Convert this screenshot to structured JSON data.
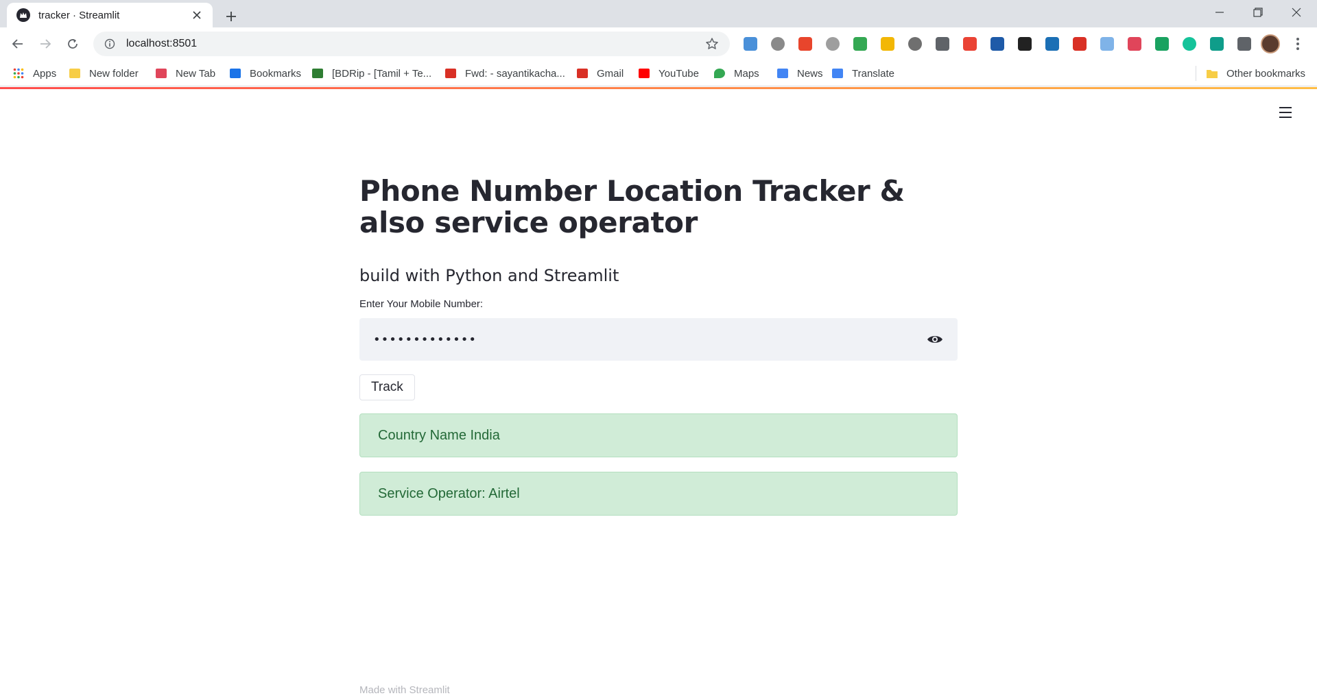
{
  "browser": {
    "tab_title": "tracker · Streamlit",
    "url": "localhost:8501",
    "extensions": [
      {
        "name": "google-translate-icon",
        "color": "#4a90d9"
      },
      {
        "name": "search-ext-icon",
        "color": "#8a8a8a"
      },
      {
        "name": "bracket-ext-icon",
        "color": "#e8452c"
      },
      {
        "name": "magnifier-ext-icon",
        "color": "#9e9e9e"
      },
      {
        "name": "chrome-ext-icon",
        "color": "#34a853"
      },
      {
        "name": "paytm-ext-icon",
        "color": "#f2b705"
      },
      {
        "name": "globe-ext-icon",
        "color": "#6f6f6f"
      },
      {
        "name": "gamepad-ext-icon",
        "color": "#5f6368"
      },
      {
        "name": "chrome2-ext-icon",
        "color": "#ea4335"
      },
      {
        "name": "clapper-ext-icon",
        "color": "#1e5aa8"
      },
      {
        "name": "card-ext-icon",
        "color": "#222222"
      },
      {
        "name": "clapper2-ext-icon",
        "color": "#1b6fb5"
      },
      {
        "name": "forward-ext-icon",
        "color": "#d93025"
      },
      {
        "name": "doc-ext-icon",
        "color": "#7fb3e8"
      },
      {
        "name": "tv-ext-icon",
        "color": "#e0455a"
      },
      {
        "name": "shield-ext-icon",
        "color": "#1aa260"
      },
      {
        "name": "grammarly-icon",
        "color": "#15c39a"
      },
      {
        "name": "pen-ext-icon",
        "color": "#0f9d8a"
      },
      {
        "name": "puzzle-icon",
        "color": "#5f6368"
      }
    ]
  },
  "bookmarks": {
    "apps": "Apps",
    "items": [
      {
        "label": "New folder",
        "color": "#f7cd46"
      },
      {
        "label": "New Tab",
        "color": "#e0455a"
      },
      {
        "label": "Bookmarks",
        "color": "#1a73e8"
      },
      {
        "label": "[BDRip - [Tamil + Te...",
        "color": "#2e7d32"
      },
      {
        "label": "Fwd: - sayantikacha...",
        "color": "#d93025"
      },
      {
        "label": "Gmail",
        "color": "#d93025"
      },
      {
        "label": "YouTube",
        "color": "#ff0000"
      },
      {
        "label": "Maps",
        "color": "#34a853"
      },
      {
        "label": "News",
        "color": "#4285f4"
      },
      {
        "label": "Translate",
        "color": "#4285f4"
      }
    ],
    "other": "Other bookmarks"
  },
  "app": {
    "title": "Phone Number Location Tracker & also service operator",
    "subtitle": "build with Python and Streamlit",
    "input_label": "Enter Your Mobile Number:",
    "input_value": "•••••••••••••",
    "track_button": "Track",
    "result_country": "Country Name India",
    "result_operator": "Service Operator: Airtel",
    "footer": "Made with Streamlit"
  },
  "colors": {
    "accent": "#ff4b4b",
    "success_bg": "#d0ecd7",
    "success_text": "#236937",
    "input_bg": "#f0f2f6"
  }
}
